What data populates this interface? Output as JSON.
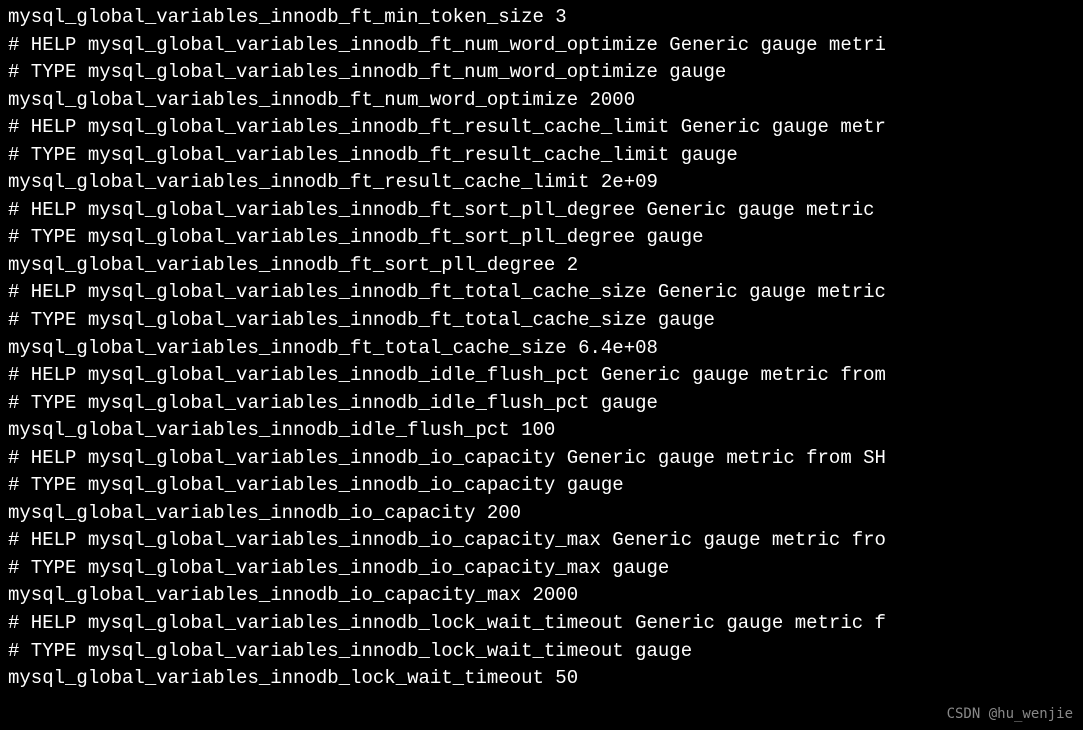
{
  "lines": [
    "mysql_global_variables_innodb_ft_min_token_size 3",
    "# HELP mysql_global_variables_innodb_ft_num_word_optimize Generic gauge metri",
    "# TYPE mysql_global_variables_innodb_ft_num_word_optimize gauge",
    "mysql_global_variables_innodb_ft_num_word_optimize 2000",
    "# HELP mysql_global_variables_innodb_ft_result_cache_limit Generic gauge metr",
    "# TYPE mysql_global_variables_innodb_ft_result_cache_limit gauge",
    "mysql_global_variables_innodb_ft_result_cache_limit 2e+09",
    "# HELP mysql_global_variables_innodb_ft_sort_pll_degree Generic gauge metric ",
    "# TYPE mysql_global_variables_innodb_ft_sort_pll_degree gauge",
    "mysql_global_variables_innodb_ft_sort_pll_degree 2",
    "# HELP mysql_global_variables_innodb_ft_total_cache_size Generic gauge metric",
    "# TYPE mysql_global_variables_innodb_ft_total_cache_size gauge",
    "mysql_global_variables_innodb_ft_total_cache_size 6.4e+08",
    "# HELP mysql_global_variables_innodb_idle_flush_pct Generic gauge metric from",
    "# TYPE mysql_global_variables_innodb_idle_flush_pct gauge",
    "mysql_global_variables_innodb_idle_flush_pct 100",
    "# HELP mysql_global_variables_innodb_io_capacity Generic gauge metric from SH",
    "# TYPE mysql_global_variables_innodb_io_capacity gauge",
    "mysql_global_variables_innodb_io_capacity 200",
    "# HELP mysql_global_variables_innodb_io_capacity_max Generic gauge metric fro",
    "# TYPE mysql_global_variables_innodb_io_capacity_max gauge",
    "mysql_global_variables_innodb_io_capacity_max 2000",
    "# HELP mysql_global_variables_innodb_lock_wait_timeout Generic gauge metric f",
    "# TYPE mysql_global_variables_innodb_lock_wait_timeout gauge",
    "mysql_global_variables_innodb_lock_wait_timeout 50"
  ],
  "watermark": "CSDN @hu_wenjie"
}
